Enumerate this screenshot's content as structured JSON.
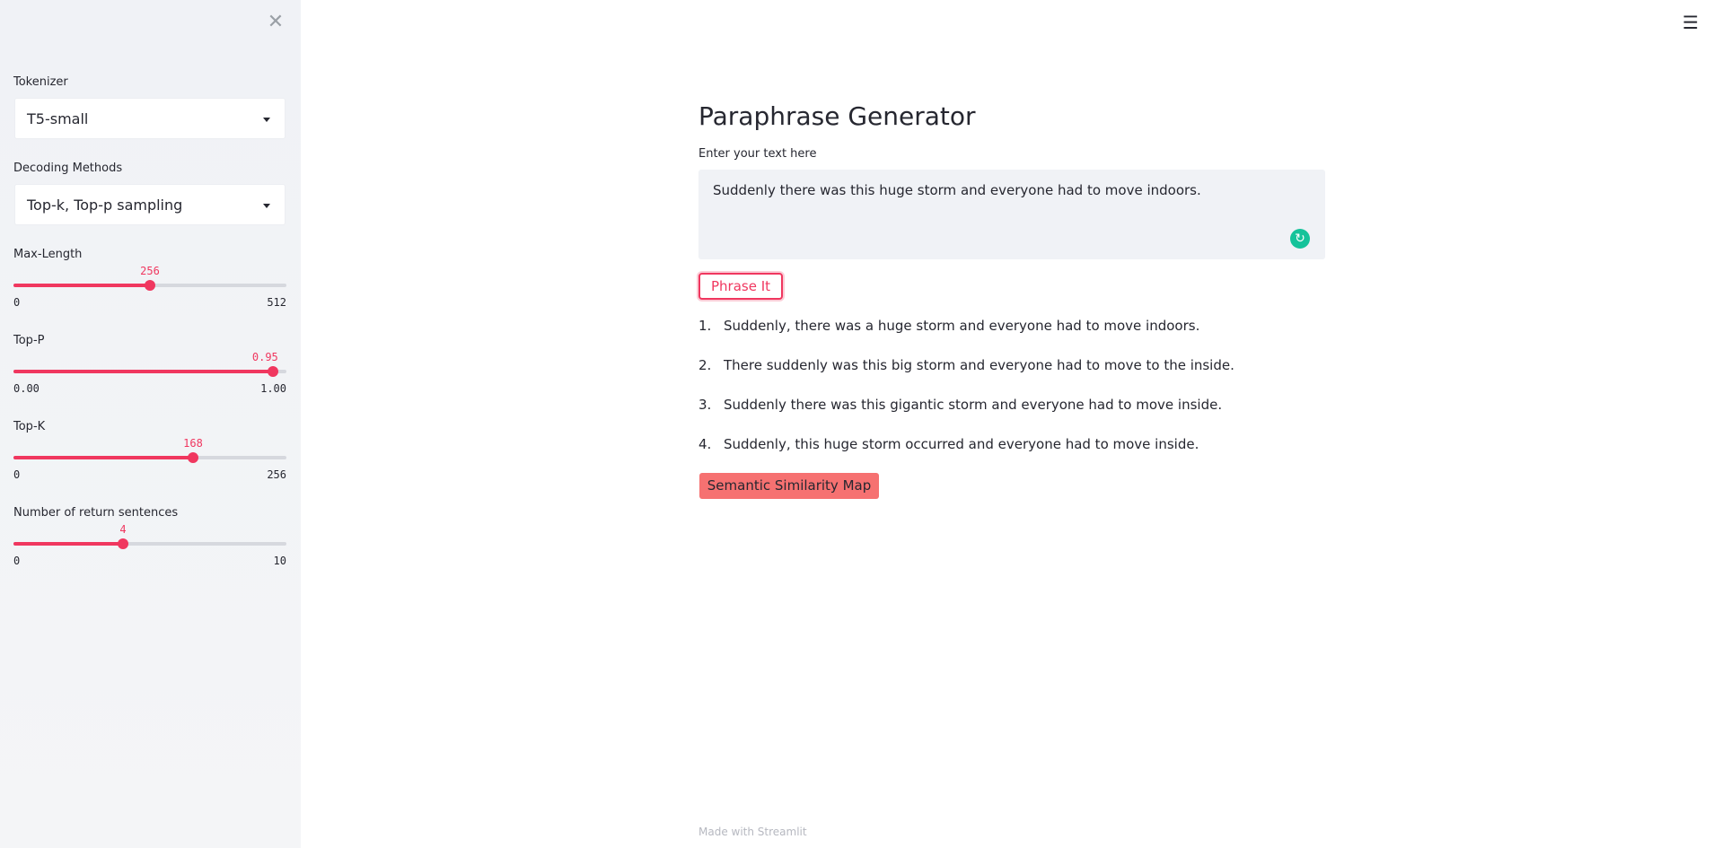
{
  "sidebar": {
    "close_glyph": "✕",
    "tokenizer": {
      "label": "Tokenizer",
      "value": "T5-small"
    },
    "decoding": {
      "label": "Decoding Methods",
      "value": "Top-k, Top-p sampling"
    },
    "sliders": [
      {
        "label": "Max-Length",
        "value": "256",
        "min": "0",
        "max": "512",
        "fraction": 0.5
      },
      {
        "label": "Top-P",
        "value": "0.95",
        "min": "0.00",
        "max": "1.00",
        "fraction": 0.95
      },
      {
        "label": "Top-K",
        "value": "168",
        "min": "0",
        "max": "256",
        "fraction": 0.65625
      },
      {
        "label": "Number of return sentences",
        "value": "4",
        "min": "0",
        "max": "10",
        "fraction": 0.4
      }
    ]
  },
  "header": {
    "menu_glyph": "☰"
  },
  "main": {
    "title": "Paraphrase Generator",
    "input_label": "Enter your text here",
    "input_value": "Suddenly there was this huge storm and everyone had to move indoors.",
    "phrase_button": "Phrase It",
    "results": [
      {
        "num": "1.",
        "text": "Suddenly, there was a huge storm and everyone had to move indoors."
      },
      {
        "num": "2.",
        "text": "There suddenly was this big storm and everyone had to move to the inside."
      },
      {
        "num": "3.",
        "text": "Suddenly there was this gigantic storm and everyone had to move inside."
      },
      {
        "num": "4.",
        "text": "Suddenly, this huge storm occurred and everyone had to move inside."
      }
    ],
    "semantic_button": "Semantic Similarity Map",
    "footer": "Made with Streamlit"
  },
  "colors": {
    "accent": "#f0375f",
    "sidebar_bg": "#f0f2f6",
    "semantic_button_bg": "#f67171",
    "grammarly": "#15c39a"
  },
  "icons": {
    "close": "close-icon",
    "menu": "hamburger-menu-icon",
    "caret": "chevron-down-icon",
    "grammarly": "grammarly-icon"
  }
}
